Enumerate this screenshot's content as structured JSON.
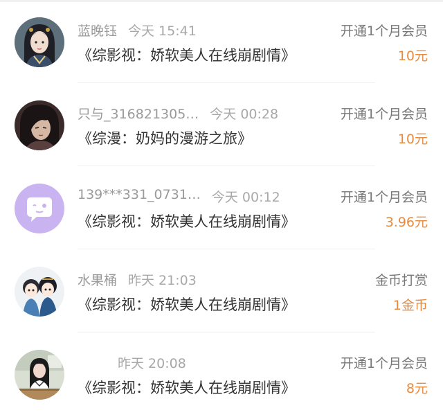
{
  "items": [
    {
      "username": "蓝晚钰",
      "time": "今天 15:41",
      "type": "开通1个月会员",
      "title": "《综影视：娇软美人在线崩剧情》",
      "amount": "10元",
      "avatar_icon": "avatar-anime-girl"
    },
    {
      "username": "只与_316821305…",
      "time": "今天 00:28",
      "type": "开通1个月会员",
      "title": "《综漫：奶妈的漫游之旅》",
      "amount": "10元",
      "avatar_icon": "avatar-anime-boy-dark"
    },
    {
      "username": "139***331_0731…",
      "time": "今天 00:12",
      "type": "开通1个月会员",
      "title": "《综影视：娇软美人在线崩剧情》",
      "amount": "3.96元",
      "avatar_icon": "avatar-default-chat"
    },
    {
      "username": "水果桶",
      "time": "昨天 21:03",
      "type": "金币打赏",
      "title": "《综影视：娇软美人在线崩剧情》",
      "amount": "1金币",
      "avatar_icon": "avatar-cartoon-couple"
    },
    {
      "username": "",
      "time": "昨天 20:08",
      "type": "开通1个月会员",
      "title": "《综影视：娇软美人在线崩剧情》",
      "amount": "8元",
      "avatar_icon": "avatar-classroom-girl"
    }
  ],
  "colors": {
    "amount": "#e88a3e",
    "meta": "#9a9a9a",
    "title": "#333333",
    "default_avatar_bg": "#c9b3f0"
  }
}
